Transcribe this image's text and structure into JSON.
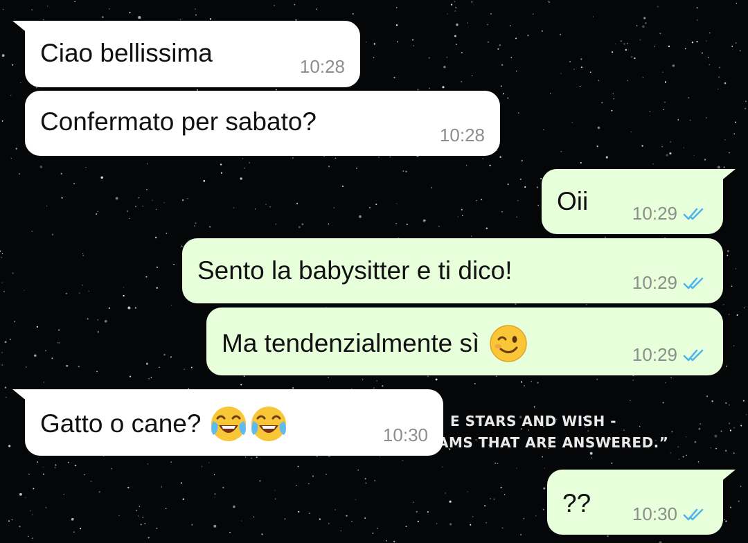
{
  "colors": {
    "incoming_bubble": "#ffffff",
    "outgoing_bubble": "#e7ffdb",
    "read_ticks": "#4fb6ec",
    "time_text": "#8a8f8a",
    "wallpaper": "#050608"
  },
  "wallpaper_text": {
    "line1": "E STARS AND WISH -",
    "line2": "AMS THAT ARE ANSWERED.”"
  },
  "messages": [
    {
      "direction": "in",
      "text": "Ciao bellissima",
      "time": "10:28"
    },
    {
      "direction": "in",
      "text": "Confermato per sabato?",
      "time": "10:28"
    },
    {
      "direction": "out",
      "text": "Oii",
      "time": "10:29",
      "status": "read"
    },
    {
      "direction": "out",
      "text": "Sento la babysitter e ti dico!",
      "time": "10:29",
      "status": "read"
    },
    {
      "direction": "out",
      "text": "Ma tendenzialmente sì",
      "emoji": [
        "winking-face"
      ],
      "time": "10:29",
      "status": "read"
    },
    {
      "direction": "in",
      "text": "Gatto o cane?",
      "emoji": [
        "tears-of-joy-face",
        "tears-of-joy-face"
      ],
      "time": "10:30"
    },
    {
      "direction": "out",
      "text": "??",
      "time": "10:30",
      "status": "read"
    }
  ]
}
